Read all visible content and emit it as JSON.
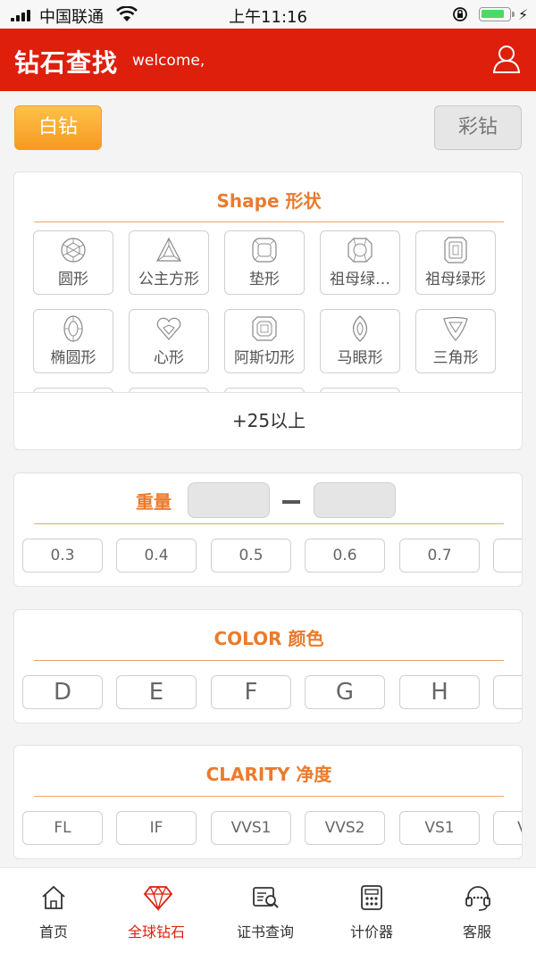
{
  "status_bar": {
    "carrier": "中国联通",
    "time": "上午11:16",
    "battery_level": 0.85
  },
  "header": {
    "title": "钻石查找",
    "welcome": "welcome,",
    "icons": {
      "user": "user-icon"
    }
  },
  "type_buttons": {
    "white": "白钻",
    "colored": "彩钻"
  },
  "shape": {
    "title": "Shape 形状",
    "items": [
      {
        "label": "圆形",
        "icon": "round-diamond-icon"
      },
      {
        "label": "公主方形",
        "icon": "princess-diamond-icon"
      },
      {
        "label": "垫形",
        "icon": "cushion-diamond-icon"
      },
      {
        "label": "祖母绿…",
        "icon": "asscher-emerald-diamond-icon"
      },
      {
        "label": "祖母绿形",
        "icon": "emerald-diamond-icon"
      },
      {
        "label": "椭圆形",
        "icon": "oval-diamond-icon"
      },
      {
        "label": "心形",
        "icon": "heart-diamond-icon"
      },
      {
        "label": "阿斯切形",
        "icon": "asscher-diamond-icon"
      },
      {
        "label": "马眼形",
        "icon": "marquise-diamond-icon"
      },
      {
        "label": "三角形",
        "icon": "trillion-diamond-icon"
      }
    ],
    "more": "+25以上"
  },
  "weight": {
    "title": "重量",
    "min_value": "",
    "max_value": "",
    "options": [
      "0.3",
      "0.4",
      "0.5",
      "0.6",
      "0.7",
      ""
    ]
  },
  "color": {
    "title": "COLOR 颜色",
    "options": [
      "D",
      "E",
      "F",
      "G",
      "H",
      ""
    ]
  },
  "clarity": {
    "title": "CLARITY 净度",
    "options": [
      "FL",
      "IF",
      "VVS1",
      "VVS2",
      "VS1",
      "V"
    ]
  },
  "tabbar": {
    "items": [
      {
        "label": "首页",
        "icon": "home-icon"
      },
      {
        "label": "全球钻石",
        "icon": "diamond-icon"
      },
      {
        "label": "证书查询",
        "icon": "certificate-search-icon"
      },
      {
        "label": "计价器",
        "icon": "calculator-icon"
      },
      {
        "label": "客服",
        "icon": "headset-icon"
      }
    ],
    "active_index": 1
  },
  "colors": {
    "brand_red": "#dd1f0c",
    "accent_orange": "#ea7b2d",
    "button_gold": "#f59a1f"
  }
}
